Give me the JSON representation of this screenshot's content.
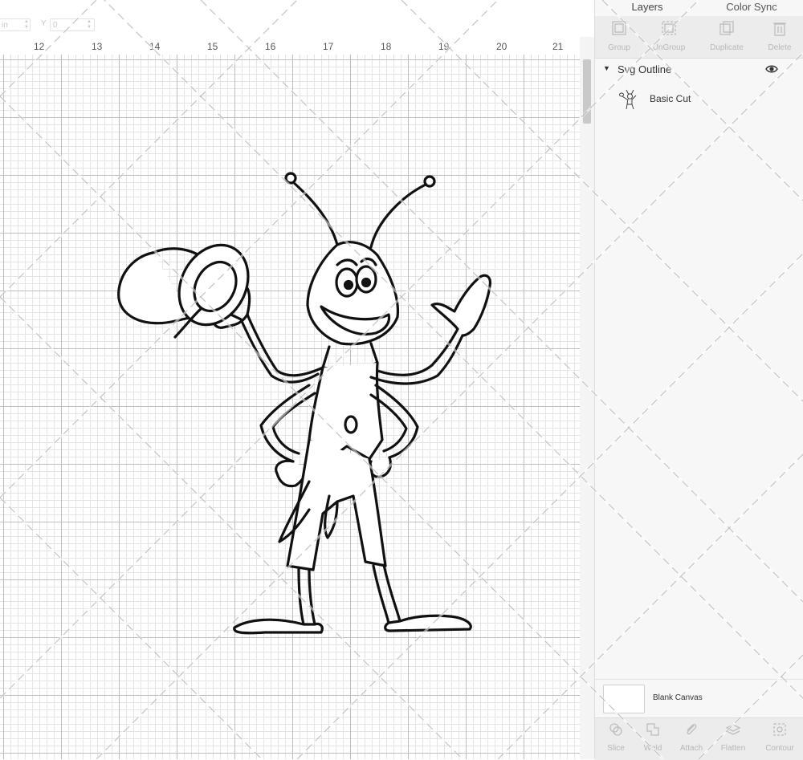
{
  "toolbar": {
    "x_partial": "in",
    "y_label": "Y",
    "y_value": "0"
  },
  "ruler": {
    "labels": [
      "12",
      "13",
      "14",
      "15",
      "16",
      "17",
      "18",
      "19",
      "20",
      "21"
    ]
  },
  "panel": {
    "tabs": [
      "Layers",
      "Color Sync"
    ],
    "actions": [
      "Group",
      "UnGroup",
      "Duplicate",
      "Delete"
    ],
    "group": {
      "name": "Svg Outline",
      "expanded": true,
      "visible": true
    },
    "layer": {
      "name": "Basic Cut"
    },
    "canvas_row": {
      "label": "Blank Canvas"
    },
    "bottom_actions": [
      "Slice",
      "Weld",
      "Attach",
      "Flatten",
      "Contour"
    ]
  },
  "colors": {
    "panel_bg": "#f7f7f7",
    "grid_major": "#bdbdbd",
    "grid_minor": "#e4e4e4",
    "disabled_text": "#b7b7b7"
  },
  "icons": {
    "panel": [
      "group-icon",
      "ungroup-icon",
      "duplicate-icon",
      "delete-icon",
      "eye-icon"
    ],
    "bottom": [
      "slice-icon",
      "weld-icon",
      "attach-icon",
      "flatten-icon",
      "contour-icon"
    ]
  }
}
